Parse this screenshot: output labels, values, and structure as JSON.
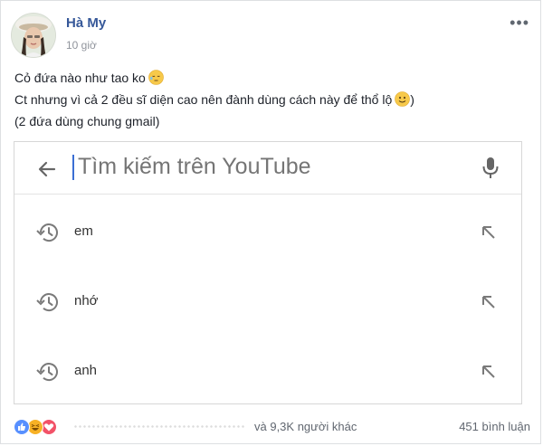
{
  "post": {
    "author": "Hà My",
    "time": "10 giờ",
    "lines": [
      "Cỏ đứa nào như tao ko",
      "Ct nhưng vì cả 2 đều sĩ diện cao nên đành dùng cách này để thổ lộ",
      "(2 đứa dùng chung gmail)"
    ],
    "emojis": [
      "sleepy-face-emoji",
      "smiling-face-emoji"
    ]
  },
  "youtube_search": {
    "placeholder": "Tìm kiếm trên YouTube",
    "history": [
      "em",
      "nhớ",
      "anh"
    ],
    "icons": [
      "back-arrow-icon",
      "microphone-icon",
      "history-icon",
      "arrow-up-left-icon"
    ]
  },
  "footer": {
    "reaction_icons": [
      "like-icon",
      "haha-icon",
      "love-icon"
    ],
    "others_text": "và 9,3K người khác",
    "comments_text": "451 bình luận"
  },
  "colors": {
    "author_link": "#365899",
    "meta_text": "#90949c",
    "like_blue": "#5890ff",
    "haha_yellow": "#f7b125",
    "love_red": "#f25268",
    "caret_blue": "#3b6fd4"
  }
}
